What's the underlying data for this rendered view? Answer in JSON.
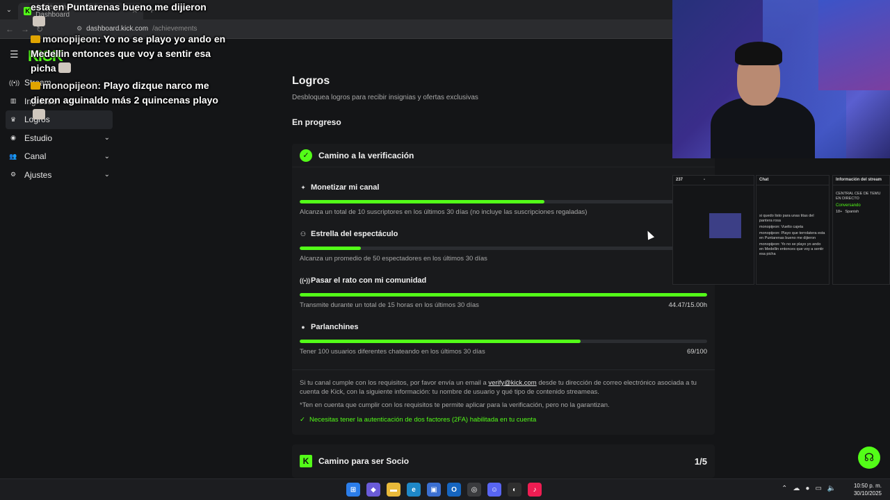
{
  "browser": {
    "tab_title": "Achievements - Kick Dashboard",
    "url_domain": "dashboard.kick.com",
    "url_path": "/achievements"
  },
  "header": {
    "logo": "KICK"
  },
  "sidebar": {
    "items": [
      {
        "label": "Stream",
        "icon": "radio-icon",
        "has_chevron": false,
        "active": false
      },
      {
        "label": "Ingresos",
        "icon": "chart-icon",
        "has_chevron": false,
        "active": false
      },
      {
        "label": "Logros",
        "icon": "trophy-icon",
        "has_chevron": false,
        "active": true
      },
      {
        "label": "Estudio",
        "icon": "studio-icon",
        "has_chevron": true,
        "active": false
      },
      {
        "label": "Canal",
        "icon": "users-icon",
        "has_chevron": true,
        "active": false
      },
      {
        "label": "Ajustes",
        "icon": "gear-icon",
        "has_chevron": true,
        "active": false
      }
    ]
  },
  "main": {
    "title": "Logros",
    "subtitle": "Desbloquea logros para recibir insignias y ofertas exclusivas",
    "section_title": "En progreso",
    "card": {
      "title": "Camino a la verificación",
      "achievements": [
        {
          "title": "Monetizar mi canal",
          "icon": "sparkle-icon",
          "progress": 0.6,
          "description": "Alcanza un total de 10 suscriptores en los últimos 30 días (no incluye las suscripciones regaladas)",
          "value": ""
        },
        {
          "title": "Estrella del espectáculo",
          "icon": "viewers-icon",
          "progress": 0.15,
          "description": "Alcanza un promedio de 50 espectadores en los últimos 30 días",
          "value": ""
        },
        {
          "title": "Pasar el rato con mi comunidad",
          "icon": "broadcast-icon",
          "progress": 1.0,
          "description": "Transmite durante un total de 15 horas en los últimos 30 días",
          "value": "44.47/15.00h"
        },
        {
          "title": "Parlanchines",
          "icon": "chat-icon",
          "progress": 0.69,
          "description": "Tener 100 usuarios diferentes chateando en los últimos 30 días",
          "value": "69/100"
        }
      ],
      "note_before_link": "Si tu canal cumple con los requisitos, por favor envía un email a ",
      "note_link": "verify@kick.com",
      "note_after_link": " desde tu dirección de correo electrónico asociada a tu cuenta de Kick, con la siguiente información: tu nombre de usuario y qué tipo de contenido streameas.",
      "disclaimer": "*Ten en cuenta que cumplir con los requisitos te permite aplicar para la verificación, pero no la garantizan.",
      "requirement": "Necesitas tener la autenticación de dos factores (2FA) habilitada en tu cuenta"
    },
    "card2": {
      "title": "Camino para ser Socio",
      "count": "1/5"
    }
  },
  "overlay_chat": [
    {
      "user": "",
      "text": "esta en Puntarenas bueno me dijieron"
    },
    {
      "user": "monopijeon:",
      "text": "Yo no se playo yo ando en Medellin entonces que voy a sentir esa picha"
    },
    {
      "user": "monopijeon:",
      "text": "Playo dizque narco me dieron aguinaldo más 2 quincenas playo"
    }
  ],
  "mini_panels": {
    "stats_value": "237",
    "stats_dash": "-",
    "chat_title": "Chat",
    "chat_lines": [
      "si quedo listo para unas titas del pantera rosa",
      "monopijeon: Vuelto cajeta",
      "monopijeon: Playo que terrolatera esta en Puntarenas bueno me dijieron",
      "monopijeon: Yo no se playo yo ando en Medellin entonces que voy a sentir esa picha"
    ],
    "info_title": "Información del stream",
    "info_stream": "CENTRAL CEE DE TEMU EN DIRECTO",
    "info_category": "Conversando",
    "info_tags": [
      "18+",
      "Spanish"
    ]
  },
  "taskbar": {
    "time": "10:50 p. m.",
    "date": "30/10/2025"
  },
  "colors": {
    "accent": "#53fc18",
    "background": "#141517",
    "card": "#191a1c"
  }
}
